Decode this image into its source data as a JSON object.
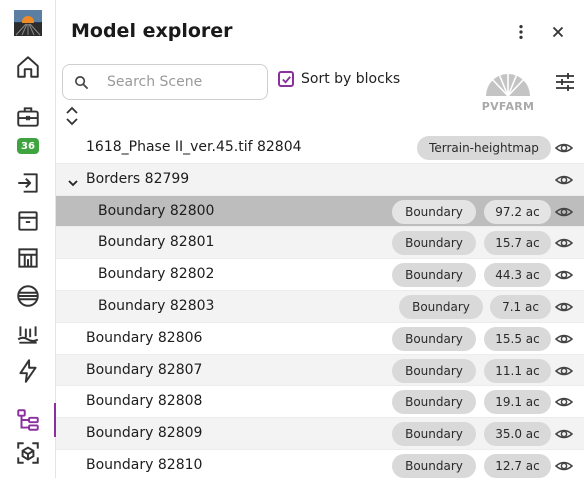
{
  "colors": {
    "accent": "#8a2f9e",
    "badge": "#3fa33f"
  },
  "sidebar": {
    "badge_count": "36",
    "items": [
      {
        "name": "home-icon"
      },
      {
        "name": "toolbox-icon"
      },
      {
        "name": "import-icon"
      },
      {
        "name": "package-icon"
      },
      {
        "name": "layout-icon"
      },
      {
        "name": "road-icon"
      },
      {
        "name": "terrain-icon"
      },
      {
        "name": "lightning-icon"
      },
      {
        "name": "tree-structure-icon",
        "active": true
      },
      {
        "name": "scan-cube-icon"
      }
    ]
  },
  "panel": {
    "title": "Model explorer",
    "search": {
      "placeholder": "Search Scene",
      "value": ""
    },
    "sort_by_blocks": {
      "label": "Sort by blocks",
      "checked": true
    },
    "logo_text": "PVFARM"
  },
  "rows": [
    {
      "label": "1618_Phase II_ver.45.tif 82804",
      "tag": "Terrain-heightmap"
    },
    {
      "label": "Borders 82799",
      "group": true,
      "expanded": true
    },
    {
      "label": "Boundary 82800",
      "tag": "Boundary",
      "area": "97.2 ac",
      "selected": true
    },
    {
      "label": "Boundary 82801",
      "tag": "Boundary",
      "area": "15.7 ac"
    },
    {
      "label": "Boundary 82802",
      "tag": "Boundary",
      "area": "44.3 ac"
    },
    {
      "label": "Boundary 82803",
      "tag": "Boundary",
      "area": "7.1 ac"
    },
    {
      "label": "Boundary 82806",
      "tag": "Boundary",
      "area": "15.5 ac"
    },
    {
      "label": "Boundary 82807",
      "tag": "Boundary",
      "area": "11.1 ac"
    },
    {
      "label": "Boundary 82808",
      "tag": "Boundary",
      "area": "19.1 ac"
    },
    {
      "label": "Boundary 82809",
      "tag": "Boundary",
      "area": "35.0 ac"
    },
    {
      "label": "Boundary 82810",
      "tag": "Boundary",
      "area": "12.7 ac"
    }
  ]
}
